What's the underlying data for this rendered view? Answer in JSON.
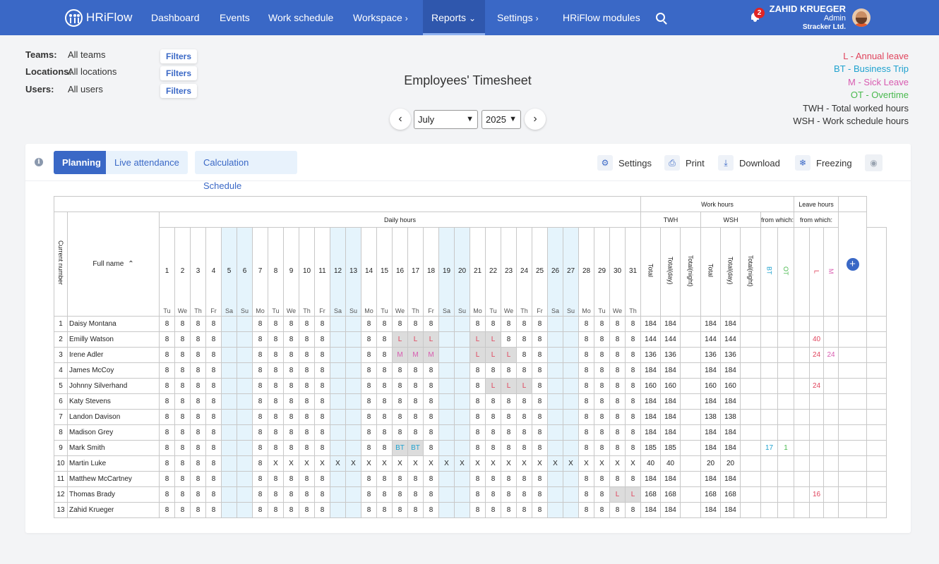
{
  "nav": {
    "logo": "HRiFlow",
    "items": [
      {
        "label": "Dashboard",
        "chevron": ""
      },
      {
        "label": "Events",
        "chevron": ""
      },
      {
        "label": "Work schedule",
        "chevron": ""
      },
      {
        "label": "Workspace",
        "chevron": "›"
      },
      {
        "label": "Reports",
        "chevron": "⌄"
      },
      {
        "label": "Settings",
        "chevron": "›"
      },
      {
        "label": "HRiFlow modules",
        "chevron": ""
      }
    ],
    "notification_count": "2",
    "user": {
      "name": "ZAHID KRUEGER",
      "role": "Admin",
      "company": "Stracker Ltd."
    }
  },
  "filters": [
    {
      "label": "Teams:",
      "value": "All teams",
      "button": "Filters"
    },
    {
      "label": "Locations:",
      "value": "All locations",
      "button": "Filters"
    },
    {
      "label": "Users:",
      "value": "All users",
      "button": "Filters"
    }
  ],
  "title": "Employees' Timesheet",
  "period": {
    "month": "July",
    "year": "2025",
    "prev": "‹",
    "next": "›"
  },
  "legend": [
    {
      "text": "L - Annual leave",
      "color": "#e0435c"
    },
    {
      "text": "BT - Business Trip",
      "color": "#1fa2cf"
    },
    {
      "text": "M - Sick Leave",
      "color": "#d85bb0"
    },
    {
      "text": "OT - Overtime",
      "color": "#48b94d"
    },
    {
      "text": "TWH - Total worked hours",
      "color": "#333333"
    },
    {
      "text": "WSH - Work schedule hours",
      "color": "#333333"
    }
  ],
  "tabs": {
    "planning": "Planning",
    "live": "Live attendance",
    "calc": "Calculation Schedule"
  },
  "tools": {
    "settings": "Settings",
    "print": "Print",
    "download": "Download",
    "freezing": "Freezing"
  },
  "table": {
    "current_number": "Current number",
    "full_name": "Full name",
    "daily_hours": "Daily hours",
    "work_hours": "Work hours",
    "leave_hours": "Leave hours",
    "twh": "TWH",
    "wsh": "WSH",
    "from_which": "from which:",
    "sub_total": "Total",
    "sub_total_day": "Total(day)",
    "sub_total_night": "Total(night)",
    "bt": "BT",
    "ot": "OT",
    "l": "L",
    "m": "M",
    "days": [
      "1",
      "2",
      "3",
      "4",
      "5",
      "6",
      "7",
      "8",
      "9",
      "10",
      "11",
      "12",
      "13",
      "14",
      "15",
      "16",
      "17",
      "18",
      "19",
      "20",
      "21",
      "22",
      "23",
      "24",
      "25",
      "26",
      "27",
      "28",
      "29",
      "30",
      "31"
    ],
    "weekdays": [
      "Tu",
      "We",
      "Th",
      "Fr",
      "Sa",
      "Su",
      "Mo",
      "Tu",
      "We",
      "Th",
      "Fr",
      "Sa",
      "Su",
      "Mo",
      "Tu",
      "We",
      "Th",
      "Fr",
      "Sa",
      "Su",
      "Mo",
      "Tu",
      "We",
      "Th",
      "Fr",
      "Sa",
      "Su",
      "Mo",
      "Tu",
      "We",
      "Th"
    ],
    "rows": [
      {
        "num": "1",
        "name": "Daisy Montana",
        "d": [
          "8",
          "8",
          "8",
          "8",
          "",
          "",
          "8",
          "8",
          "8",
          "8",
          "8",
          "",
          "",
          "8",
          "8",
          "8",
          "8",
          "8",
          "",
          "",
          "8",
          "8",
          "8",
          "8",
          "8",
          "",
          "",
          "8",
          "8",
          "8",
          "8"
        ],
        "twh": "184",
        "twh_day": "184",
        "twh_night": "",
        "wsh": "184",
        "wsh_day": "184",
        "wsh_night": "",
        "bt": "",
        "ot": "",
        "l": "",
        "m": ""
      },
      {
        "num": "2",
        "name": "Emilly Watson",
        "d": [
          "8",
          "8",
          "8",
          "8",
          "",
          "",
          "8",
          "8",
          "8",
          "8",
          "8",
          "",
          "",
          "8",
          "8",
          "L",
          "L",
          "L",
          "",
          "",
          "L",
          "L",
          "8",
          "8",
          "8",
          "",
          "",
          "8",
          "8",
          "8",
          "8"
        ],
        "twh": "144",
        "twh_day": "144",
        "twh_night": "",
        "wsh": "144",
        "wsh_day": "144",
        "wsh_night": "",
        "bt": "",
        "ot": "",
        "l": "40",
        "m": ""
      },
      {
        "num": "3",
        "name": "Irene Adler",
        "d": [
          "8",
          "8",
          "8",
          "8",
          "",
          "",
          "8",
          "8",
          "8",
          "8",
          "8",
          "",
          "",
          "8",
          "8",
          "M",
          "M",
          "M",
          "",
          "",
          "L",
          "L",
          "L",
          "8",
          "8",
          "",
          "",
          "8",
          "8",
          "8",
          "8"
        ],
        "twh": "136",
        "twh_day": "136",
        "twh_night": "",
        "wsh": "136",
        "wsh_day": "136",
        "wsh_night": "",
        "bt": "",
        "ot": "",
        "l": "24",
        "m": "24"
      },
      {
        "num": "4",
        "name": "James McCoy",
        "d": [
          "8",
          "8",
          "8",
          "8",
          "",
          "",
          "8",
          "8",
          "8",
          "8",
          "8",
          "",
          "",
          "8",
          "8",
          "8",
          "8",
          "8",
          "",
          "",
          "8",
          "8",
          "8",
          "8",
          "8",
          "",
          "",
          "8",
          "8",
          "8",
          "8"
        ],
        "twh": "184",
        "twh_day": "184",
        "twh_night": "",
        "wsh": "184",
        "wsh_day": "184",
        "wsh_night": "",
        "bt": "",
        "ot": "",
        "l": "",
        "m": ""
      },
      {
        "num": "5",
        "name": "Johnny Silverhand",
        "d": [
          "8",
          "8",
          "8",
          "8",
          "",
          "",
          "8",
          "8",
          "8",
          "8",
          "8",
          "",
          "",
          "8",
          "8",
          "8",
          "8",
          "8",
          "",
          "",
          "8",
          "L",
          "L",
          "L",
          "8",
          "",
          "",
          "8",
          "8",
          "8",
          "8"
        ],
        "twh": "160",
        "twh_day": "160",
        "twh_night": "",
        "wsh": "160",
        "wsh_day": "160",
        "wsh_night": "",
        "bt": "",
        "ot": "",
        "l": "24",
        "m": ""
      },
      {
        "num": "6",
        "name": "Katy Stevens",
        "d": [
          "8",
          "8",
          "8",
          "8",
          "",
          "",
          "8",
          "8",
          "8",
          "8",
          "8",
          "",
          "",
          "8",
          "8",
          "8",
          "8",
          "8",
          "",
          "",
          "8",
          "8",
          "8",
          "8",
          "8",
          "",
          "",
          "8",
          "8",
          "8",
          "8"
        ],
        "twh": "184",
        "twh_day": "184",
        "twh_night": "",
        "wsh": "184",
        "wsh_day": "184",
        "wsh_night": "",
        "bt": "",
        "ot": "",
        "l": "",
        "m": ""
      },
      {
        "num": "7",
        "name": "Landon Davison",
        "d": [
          "8",
          "8",
          "8",
          "8",
          "",
          "",
          "8",
          "8",
          "8",
          "8",
          "8",
          "",
          "",
          "8",
          "8",
          "8",
          "8",
          "8",
          "",
          "",
          "8",
          "8",
          "8",
          "8",
          "8",
          "",
          "",
          "8",
          "8",
          "8",
          "8"
        ],
        "twh": "184",
        "twh_day": "184",
        "twh_night": "",
        "wsh": "138",
        "wsh_day": "138",
        "wsh_night": "",
        "bt": "",
        "ot": "",
        "l": "",
        "m": ""
      },
      {
        "num": "8",
        "name": "Madison Grey",
        "d": [
          "8",
          "8",
          "8",
          "8",
          "",
          "",
          "8",
          "8",
          "8",
          "8",
          "8",
          "",
          "",
          "8",
          "8",
          "8",
          "8",
          "8",
          "",
          "",
          "8",
          "8",
          "8",
          "8",
          "8",
          "",
          "",
          "8",
          "8",
          "8",
          "8"
        ],
        "twh": "184",
        "twh_day": "184",
        "twh_night": "",
        "wsh": "184",
        "wsh_day": "184",
        "wsh_night": "",
        "bt": "",
        "ot": "",
        "l": "",
        "m": ""
      },
      {
        "num": "9",
        "name": "Mark Smith",
        "d": [
          "8",
          "8",
          "8",
          "8",
          "",
          "",
          "8",
          "8",
          "8",
          "8",
          "8",
          "",
          "",
          "8",
          "8",
          "BT",
          "BT",
          "8",
          "",
          "",
          "8",
          "8",
          "8",
          "8",
          "8",
          "",
          "",
          "8",
          "8",
          "8",
          "8"
        ],
        "twh": "185",
        "twh_day": "185",
        "twh_night": "",
        "wsh": "184",
        "wsh_day": "184",
        "wsh_night": "",
        "bt": "17",
        "ot": "1",
        "l": "",
        "m": ""
      },
      {
        "num": "10",
        "name": "Martin Luke",
        "d": [
          "8",
          "8",
          "8",
          "8",
          "",
          "",
          "8",
          "X",
          "X",
          "X",
          "X",
          "X",
          "X",
          "X",
          "X",
          "X",
          "X",
          "X",
          "X",
          "X",
          "X",
          "X",
          "X",
          "X",
          "X",
          "X",
          "X",
          "X",
          "X",
          "X",
          "X"
        ],
        "twh": "40",
        "twh_day": "40",
        "twh_night": "",
        "wsh": "20",
        "wsh_day": "20",
        "wsh_night": "",
        "bt": "",
        "ot": "",
        "l": "",
        "m": ""
      },
      {
        "num": "11",
        "name": "Matthew McCartney",
        "d": [
          "8",
          "8",
          "8",
          "8",
          "",
          "",
          "8",
          "8",
          "8",
          "8",
          "8",
          "",
          "",
          "8",
          "8",
          "8",
          "8",
          "8",
          "",
          "",
          "8",
          "8",
          "8",
          "8",
          "8",
          "",
          "",
          "8",
          "8",
          "8",
          "8"
        ],
        "twh": "184",
        "twh_day": "184",
        "twh_night": "",
        "wsh": "184",
        "wsh_day": "184",
        "wsh_night": "",
        "bt": "",
        "ot": "",
        "l": "",
        "m": ""
      },
      {
        "num": "12",
        "name": "Thomas Brady",
        "d": [
          "8",
          "8",
          "8",
          "8",
          "",
          "",
          "8",
          "8",
          "8",
          "8",
          "8",
          "",
          "",
          "8",
          "8",
          "8",
          "8",
          "8",
          "",
          "",
          "8",
          "8",
          "8",
          "8",
          "8",
          "",
          "",
          "8",
          "8",
          "L",
          "L"
        ],
        "twh": "168",
        "twh_day": "168",
        "twh_night": "",
        "wsh": "168",
        "wsh_day": "168",
        "wsh_night": "",
        "bt": "",
        "ot": "",
        "l": "16",
        "m": ""
      },
      {
        "num": "13",
        "name": "Zahid Krueger",
        "d": [
          "8",
          "8",
          "8",
          "8",
          "",
          "",
          "8",
          "8",
          "8",
          "8",
          "8",
          "",
          "",
          "8",
          "8",
          "8",
          "8",
          "8",
          "",
          "",
          "8",
          "8",
          "8",
          "8",
          "8",
          "",
          "",
          "8",
          "8",
          "8",
          "8"
        ],
        "twh": "184",
        "twh_day": "184",
        "twh_night": "",
        "wsh": "184",
        "wsh_day": "184",
        "wsh_night": "",
        "bt": "",
        "ot": "",
        "l": "",
        "m": ""
      }
    ]
  }
}
